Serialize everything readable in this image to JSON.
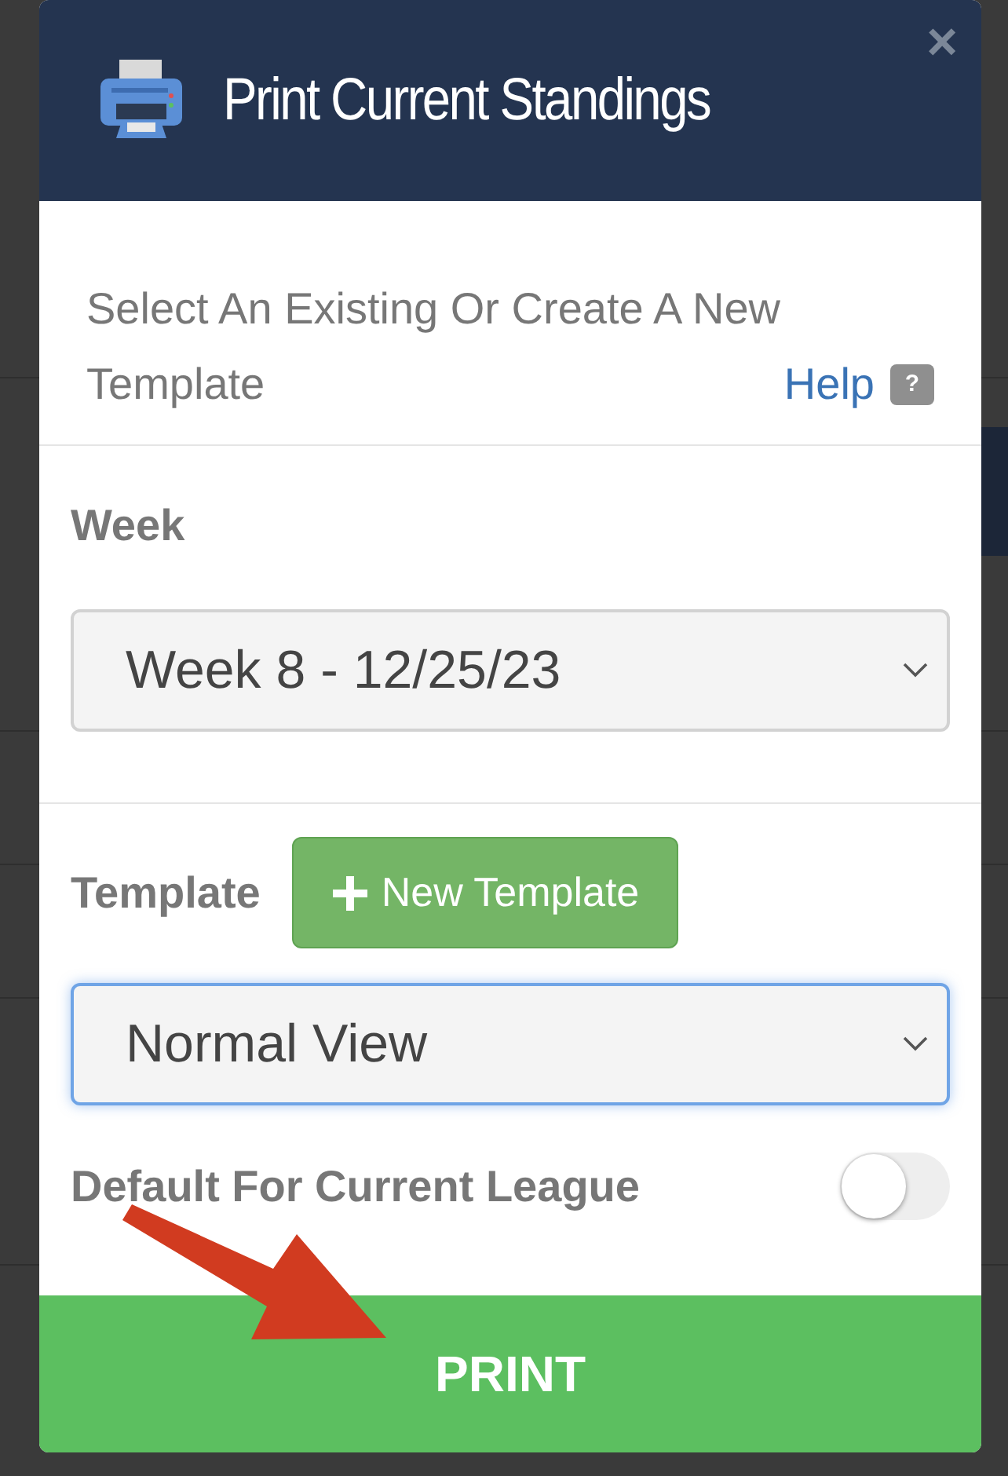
{
  "dialog": {
    "title": "Print Current Standings",
    "close": "×"
  },
  "intro": {
    "lines": [
      "Select An Existing Or Create A New",
      "Template"
    ],
    "help_link": "Help",
    "help_badge": "?"
  },
  "week": {
    "label": "Week",
    "value": "Week 8 - 12/25/23",
    "focused": false
  },
  "template": {
    "label": "Template",
    "new_button": "New Template",
    "value": "Normal View",
    "focused": true
  },
  "default_toggle": {
    "label": "Default For Current League",
    "on": false
  },
  "print_button": "PRINT"
}
